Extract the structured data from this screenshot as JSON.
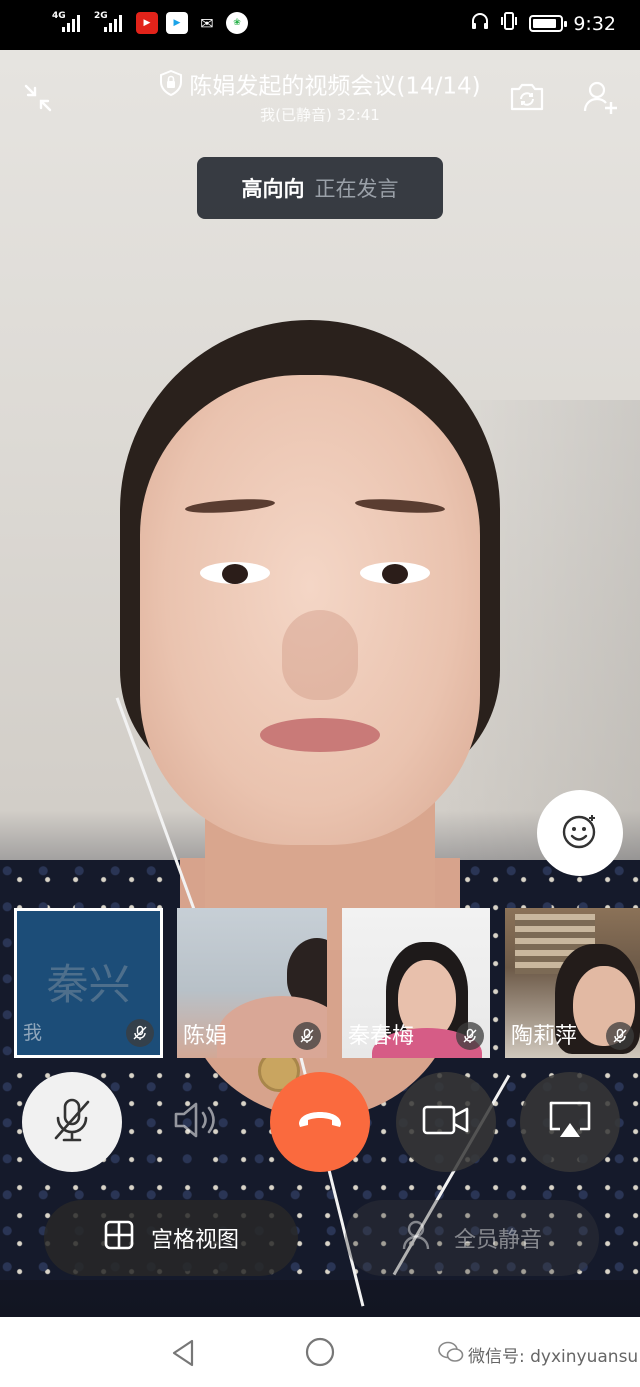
{
  "status_bar": {
    "signal1_label": "4G",
    "signal2_label": "2G",
    "app_icons": [
      "video-app-icon",
      "youku-icon",
      "wechat-icon",
      "photos-icon"
    ],
    "time": "9:32",
    "battery_level": 0.9
  },
  "meeting": {
    "title": "陈娟发起的视频会议(14/14)",
    "subtitle": "我(已静音) 32:41",
    "active_speaker": {
      "name": "高向向",
      "status": "正在发言"
    }
  },
  "participants": [
    {
      "avatar_text": "秦兴",
      "name": "我",
      "muted": true
    },
    {
      "name": "陈娟",
      "muted": true
    },
    {
      "name": "秦春梅",
      "muted": true
    },
    {
      "name": "陶莉萍",
      "muted": true
    }
  ],
  "controls": {
    "grid_view": "宫格视图",
    "mute_all": "全员静音"
  },
  "watermark": "微信号: dyxinyuansu",
  "colors": {
    "hangup": "#fa6a3e",
    "avatar_bg": "#1c4d78",
    "speaker_pill_bg": "#282c34"
  }
}
